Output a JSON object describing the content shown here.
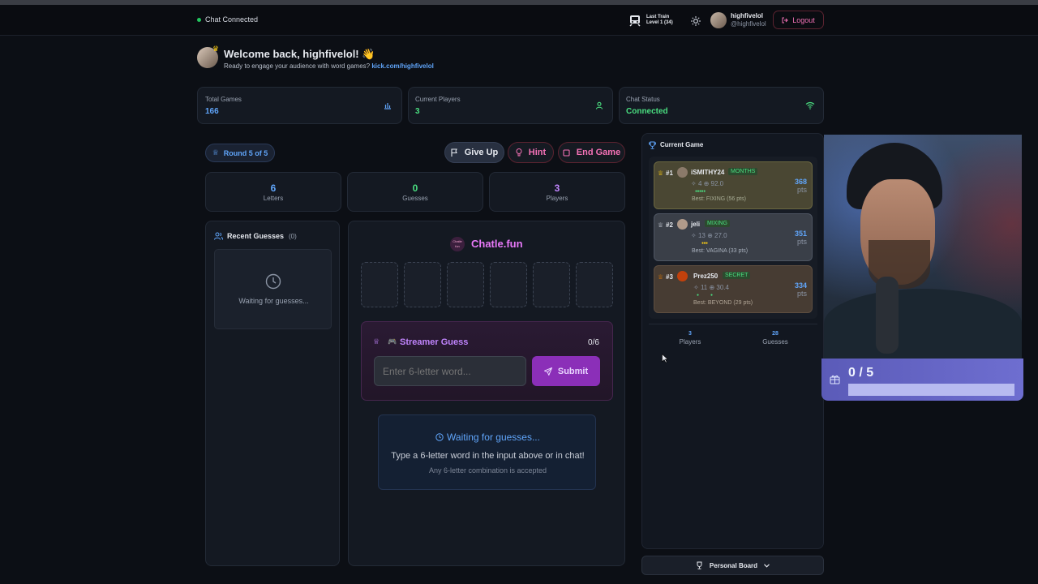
{
  "header": {
    "chat_status": "Chat Connected",
    "train_title": "Last Train",
    "train_level": "Level 1",
    "train_count": "(34)",
    "username": "highfivelol",
    "handle": "@highfivelol",
    "logout_label": "Logout"
  },
  "welcome": {
    "title": "Welcome back, highfivelol!",
    "emoji": "👋",
    "subtitle": "Ready to engage your audience with word games?",
    "link": "kick.com/highfivelol"
  },
  "stats": {
    "total_games_label": "Total Games",
    "total_games_value": "166",
    "current_players_label": "Current Players",
    "current_players_value": "3",
    "chat_status_label": "Chat Status",
    "chat_status_value": "Connected"
  },
  "game": {
    "round": "Round 5 of 5",
    "give_up": "Give Up",
    "hint": "Hint",
    "end_game": "End Game",
    "letters_value": "6",
    "letters_label": "Letters",
    "guesses_value": "0",
    "guesses_label": "Guesses",
    "players_value": "3",
    "players_label": "Players"
  },
  "recent_guesses": {
    "title": "Recent Guesses",
    "count": "(0)",
    "waiting": "Waiting for guesses..."
  },
  "board": {
    "logo_text": "Chatle.fun",
    "badge_text": "Chatle fun",
    "streamer_guess": "Streamer Guess",
    "guess_count": "0/6",
    "input_placeholder": "Enter 6-letter word...",
    "submit": "Submit",
    "waiting_title": "Waiting for guesses...",
    "waiting_line1": "Type a 6-letter word in the input above or in chat!",
    "waiting_line2": "Any 6-letter combination is accepted"
  },
  "current_game": {
    "title": "Current Game",
    "players": [
      {
        "rank": "#1",
        "name": "iSMITHY24",
        "word": "MONTHS",
        "stats_a": "4",
        "stats_b": "92.0",
        "best": "Best: FIXING (56 pts)",
        "pts": "368",
        "pts_label": "pts",
        "color": "#4a4a35",
        "tag_color": "#4ade80"
      },
      {
        "rank": "#2",
        "name": "jeli",
        "word": "MIXING",
        "stats_a": "13",
        "stats_b": "27.0",
        "best": "Best: VAGINA (33 pts)",
        "pts": "351",
        "pts_label": "pts",
        "color": "#3b4049",
        "tag_color": "#4ade80"
      },
      {
        "rank": "#3",
        "name": "Prez250",
        "word": "SECRET",
        "stats_a": "11",
        "stats_b": "30.4",
        "best": "Best: BEYOND (29 pts)",
        "pts": "334",
        "pts_label": "pts",
        "color": "#473b33",
        "tag_color": "#4ade80"
      }
    ],
    "summary_players_value": "3",
    "summary_players_label": "Players",
    "summary_guesses_value": "28",
    "summary_guesses_label": "Guesses",
    "personal_board": "Personal Board"
  },
  "overlay": {
    "goal": "0 / 5",
    "goal_progress": 0
  },
  "colors": {
    "accent_blue": "#60a5fa",
    "accent_green": "#22c55e",
    "accent_pink": "#f472b6",
    "accent_purple": "#a855f7"
  }
}
